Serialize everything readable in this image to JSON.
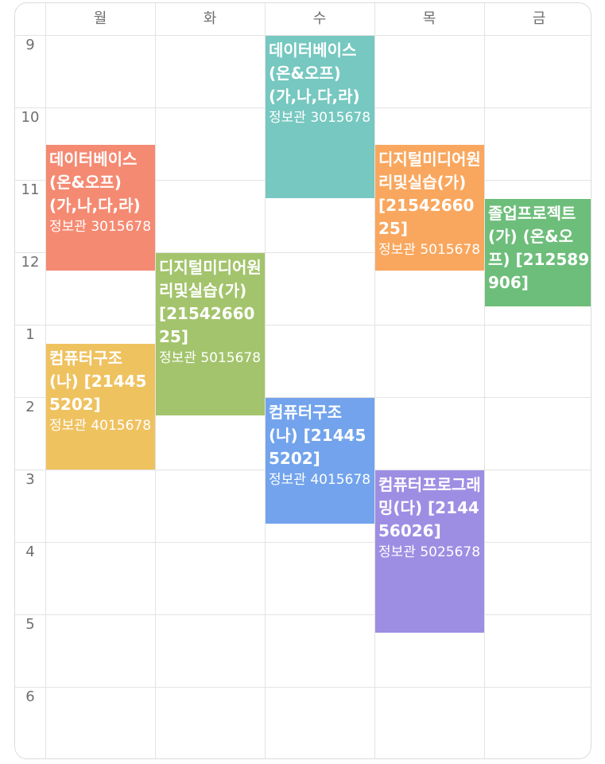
{
  "days": [
    "월",
    "화",
    "수",
    "목",
    "금"
  ],
  "hours": [
    "9",
    "10",
    "11",
    "12",
    "1",
    "2",
    "3",
    "4",
    "5",
    "6"
  ],
  "courses": [
    {
      "name": "데이터베이스(온&오프) (가,나,다,라)",
      "room": "정보관 3015678",
      "day": 0,
      "start": 10.5,
      "end": 12.25,
      "color": "#F58A72"
    },
    {
      "name": "컴퓨터구조 (나) [214455202]",
      "room": "정보관 4015678",
      "day": 0,
      "start": 13.25,
      "end": 15.0,
      "color": "#EFC260"
    },
    {
      "name": "디지털미디어원리및실습(가)[2154266025]",
      "room": "정보관 5015678",
      "day": 1,
      "start": 12.0,
      "end": 14.25,
      "color": "#A3C46C"
    },
    {
      "name": "데이터베이스(온&오프) (가,나,다,라)",
      "room": "정보관 3015678",
      "day": 2,
      "start": 9.0,
      "end": 11.25,
      "color": "#76C8C0"
    },
    {
      "name": "컴퓨터구조 (나) [214455202]",
      "room": "정보관 4015678",
      "day": 2,
      "start": 14.0,
      "end": 15.75,
      "color": "#72A3EC"
    },
    {
      "name": "디지털미디어원리및실습(가)[2154266025]",
      "room": "정보관 5015678",
      "day": 3,
      "start": 10.5,
      "end": 12.25,
      "color": "#F9A75E"
    },
    {
      "name": "컴퓨터프로그래밍(다) [214456026]",
      "room": "정보관 5025678",
      "day": 3,
      "start": 15.0,
      "end": 17.25,
      "color": "#9E8EE3"
    },
    {
      "name": "졸업프로젝트(가) (온&오프) [212589906]",
      "room": "",
      "day": 4,
      "start": 11.25,
      "end": 12.75,
      "color": "#6DBE7A"
    }
  ]
}
